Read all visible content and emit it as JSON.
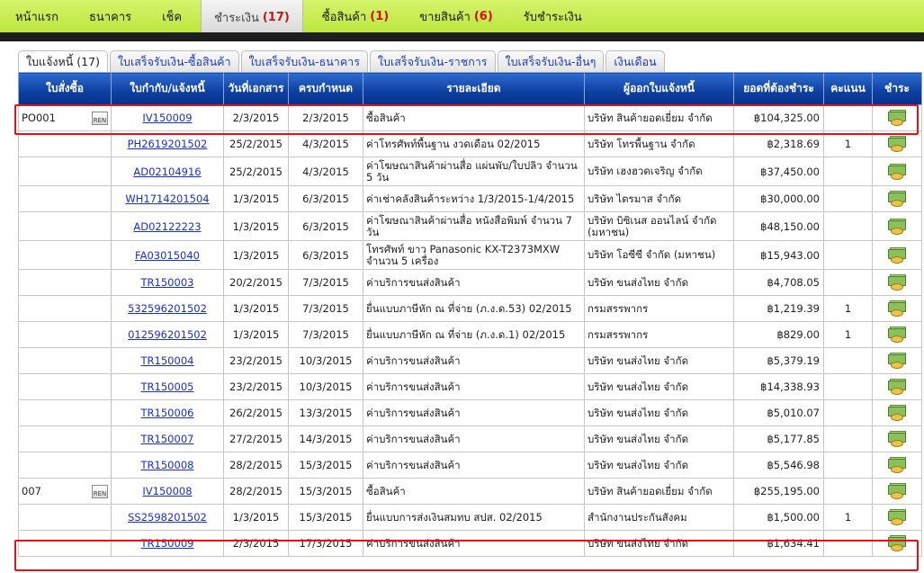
{
  "nav": [
    {
      "label": "หน้าแรก",
      "count": ""
    },
    {
      "label": "ธนาคาร",
      "count": ""
    },
    {
      "label": "เช็ค",
      "count": ""
    },
    {
      "label": "ชำระเงิน",
      "count": "(17)"
    },
    {
      "label": "ซื้อสินค้า",
      "count": "(1)"
    },
    {
      "label": "ขายสินค้า",
      "count": "(6)"
    },
    {
      "label": "รับชำระเงิน",
      "count": ""
    }
  ],
  "tabs": [
    "ใบแจ้งหนี้ (17)",
    "ใบเสร็จรับเงิน-ซื้อสินค้า",
    "ใบเสร็จรับเงิน-ธนาคาร",
    "ใบเสร็จรับเงิน-ราชการ",
    "ใบเสร็จรับเงิน-อื่นๆ",
    "เงินเดือน"
  ],
  "columns": [
    "ใบสั่งซื้อ",
    "ใบกำกับ/แจ้งหนี้",
    "วันที่เอกสาร",
    "ครบกำหนด",
    "รายละเอียด",
    "ผู้ออกใบแจ้งหนี้",
    "ยอดที่ต้องชำระ",
    "คะแนน",
    "ชำระ"
  ],
  "ren_label": "REN",
  "rows": [
    {
      "po": "PO001",
      "ren": true,
      "doc": "IV150009",
      "date": "2/3/2015",
      "due": "2/3/2015",
      "desc": "ซื้อสินค้า",
      "vendor": "บริษัท สินค้ายอดเยี่ยม จำกัด",
      "amount": "฿104,325.00",
      "score": ""
    },
    {
      "po": "",
      "ren": false,
      "doc": "PH2619201502",
      "date": "25/2/2015",
      "due": "4/3/2015",
      "desc": "ค่าโทรศัพท์พื้นฐาน งวดเดือน 02/2015",
      "vendor": "บริษัท โทรพื้นฐาน จำกัด",
      "amount": "฿2,318.69",
      "score": "1"
    },
    {
      "po": "",
      "ren": false,
      "doc": "AD02104916",
      "date": "25/2/2015",
      "due": "4/3/2015",
      "desc": "ค่าโฆษณาสินค้าผ่านสื่อ แผ่นพับ/ใบปลิว จำนวน 5 วัน",
      "vendor": "บริษัท เฮงฮวดเจริญ จำกัด",
      "amount": "฿37,450.00",
      "score": ""
    },
    {
      "po": "",
      "ren": false,
      "doc": "WH1714201504",
      "date": "1/3/2015",
      "due": "6/3/2015",
      "desc": "ค่าเช่าคลังสินค้าระหว่าง 1/3/2015-1/4/2015",
      "vendor": "บริษัท ไตรมาส จำกัด",
      "amount": "฿30,000.00",
      "score": ""
    },
    {
      "po": "",
      "ren": false,
      "doc": "AD02122223",
      "date": "1/3/2015",
      "due": "6/3/2015",
      "desc": "ค่าโฆษณาสินค้าผ่านสื่อ หนังสือพิมพ์ จำนวน 7 วัน",
      "vendor": "บริษัท บิซิเนส ออนไลน์ จำกัด (มหาชน)",
      "amount": "฿48,150.00",
      "score": ""
    },
    {
      "po": "",
      "ren": false,
      "doc": "FA03015040",
      "date": "1/3/2015",
      "due": "6/3/2015",
      "desc": "โทรศัพท์ ขาว Panasonic KX-T2373MXW จำนวน 5 เครื่อง",
      "vendor": "บริษัท โอซีซี จำกัด (มหาชน)",
      "amount": "฿15,943.00",
      "score": ""
    },
    {
      "po": "",
      "ren": false,
      "doc": "TR150003",
      "date": "20/2/2015",
      "due": "7/3/2015",
      "desc": "ค่าบริการขนส่งสินค้า",
      "vendor": "บริษัท ขนส่งไทย จำกัด",
      "amount": "฿4,708.05",
      "score": ""
    },
    {
      "po": "",
      "ren": false,
      "doc": "532596201502",
      "date": "1/3/2015",
      "due": "7/3/2015",
      "desc": "ยื่นแบบภาษีหัก ณ ที่จ่าย (ภ.ง.ด.53) 02/2015",
      "vendor": "กรมสรรพากร",
      "amount": "฿1,219.39",
      "score": "1"
    },
    {
      "po": "",
      "ren": false,
      "doc": "012596201502",
      "date": "1/3/2015",
      "due": "7/3/2015",
      "desc": "ยื่นแบบภาษีหัก ณ ที่จ่าย (ภ.ง.ด.1) 02/2015",
      "vendor": "กรมสรรพากร",
      "amount": "฿829.00",
      "score": "1"
    },
    {
      "po": "",
      "ren": false,
      "doc": "TR150004",
      "date": "23/2/2015",
      "due": "10/3/2015",
      "desc": "ค่าบริการขนส่งสินค้า",
      "vendor": "บริษัท ขนส่งไทย จำกัด",
      "amount": "฿5,379.19",
      "score": ""
    },
    {
      "po": "",
      "ren": false,
      "doc": "TR150005",
      "date": "23/2/2015",
      "due": "10/3/2015",
      "desc": "ค่าบริการขนส่งสินค้า",
      "vendor": "บริษัท ขนส่งไทย จำกัด",
      "amount": "฿14,338.93",
      "score": ""
    },
    {
      "po": "",
      "ren": false,
      "doc": "TR150006",
      "date": "26/2/2015",
      "due": "13/3/2015",
      "desc": "ค่าบริการขนส่งสินค้า",
      "vendor": "บริษัท ขนส่งไทย จำกัด",
      "amount": "฿5,010.07",
      "score": ""
    },
    {
      "po": "",
      "ren": false,
      "doc": "TR150007",
      "date": "27/2/2015",
      "due": "14/3/2015",
      "desc": "ค่าบริการขนส่งสินค้า",
      "vendor": "บริษัท ขนส่งไทย จำกัด",
      "amount": "฿5,177.85",
      "score": ""
    },
    {
      "po": "",
      "ren": false,
      "doc": "TR150008",
      "date": "28/2/2015",
      "due": "15/3/2015",
      "desc": "ค่าบริการขนส่งสินค้า",
      "vendor": "บริษัท ขนส่งไทย จำกัด",
      "amount": "฿5,546.98",
      "score": ""
    },
    {
      "po": "007",
      "ren": true,
      "doc": "IV150008",
      "date": "28/2/2015",
      "due": "15/3/2015",
      "desc": "ซื้อสินค้า",
      "vendor": "บริษัท สินค้ายอดเยี่ยม จำกัด",
      "amount": "฿255,195.00",
      "score": ""
    },
    {
      "po": "",
      "ren": false,
      "doc": "SS2598201502",
      "date": "1/3/2015",
      "due": "15/3/2015",
      "desc": "ยื่นแบบการส่งเงินสมทบ สปส. 02/2015",
      "vendor": "สำนักงานประกันสังคม",
      "amount": "฿1,500.00",
      "score": "1"
    },
    {
      "po": "",
      "ren": false,
      "doc": "TR150009",
      "date": "2/3/2015",
      "due": "17/3/2015",
      "desc": "ค่าบริการขนส่งสินค้า",
      "vendor": "บริษัท ขนส่งไทย จำกัด",
      "amount": "฿1,634.41",
      "score": ""
    }
  ]
}
